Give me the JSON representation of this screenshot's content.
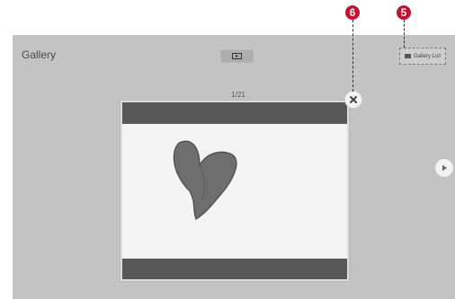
{
  "app": {
    "title": "Gallery"
  },
  "toolbar": {
    "slideshow_icon": "play-slideshow-icon",
    "gallery_list_label": "Gallery List",
    "gallery_list_icon": "list-icon"
  },
  "viewer": {
    "counter": "1/21",
    "photo_subject": "heart-drawing",
    "close_icon": "close-icon",
    "next_icon": "next-arrow-icon"
  },
  "callouts": {
    "close": "6",
    "gallery_list": "5"
  },
  "colors": {
    "background": "#c3c3c3",
    "viewer_bars": "#585858",
    "callout": "#c8102e",
    "heart": "#6e6e6e"
  }
}
